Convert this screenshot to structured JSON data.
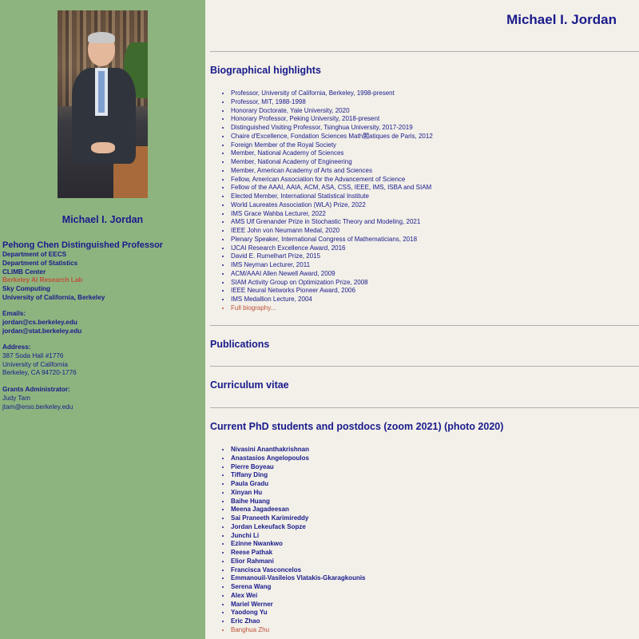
{
  "sidebar": {
    "name": "Michael I. Jordan",
    "title": "Pehong Chen Distinguished Professor",
    "affiliations": [
      {
        "label": "Department of EECS",
        "link": false
      },
      {
        "label": "Department of Statistics",
        "link": false
      },
      {
        "label": "CLIMB Center",
        "link": false
      },
      {
        "label": "Berkeley AI Research Lab",
        "link": true
      },
      {
        "label": "Sky Computing",
        "link": false
      },
      {
        "label": "University of California, Berkeley",
        "link": false
      }
    ],
    "emails_label": "Emails:",
    "emails": [
      "jordan@cs.berkeley.edu",
      "jordan@stat.berkeley.edu"
    ],
    "address_label": "Address:",
    "address": [
      "387 Soda Hall #1776",
      "University of California",
      "Berkeley, CA 94720-1776"
    ],
    "admin_label": "Grants Administrator:",
    "admin": [
      "Judy Tam",
      "jtam@erso.berkeley.edu"
    ]
  },
  "main": {
    "title": "Michael I. Jordan",
    "bio_heading": "Biographical highlights",
    "bio_items": [
      "Professor, University of California, Berkeley, 1998-present",
      "Professor, MIT, 1988-1998",
      "Honorary Doctorate, Yale University, 2020",
      "Honorary Professor, Peking University, 2018-present",
      "Distinguished Visiting Professor, Tsinghua University, 2017-2019",
      "Chaire d'Excellence, Fondation Sciences Math閣atiques de Paris, 2012",
      "Foreign Member of the Royal Society",
      "Member, National Academy of Sciences",
      "Member, National Academy of Engineering",
      "Member, American Academy of Arts and Sciences",
      "Fellow, American Association for the Advancement of Science",
      "Fellow of the AAAI, AAIA, ACM, ASA, CSS, IEEE, IMS, ISBA and SIAM",
      "Elected Member, International Statistical Institute",
      "World Laureates Association (WLA) Prize, 2022",
      "IMS Grace Wahba Lecturer, 2022",
      "AMS Ulf Grenander Prize in Stochastic Theory and Modeling, 2021",
      "IEEE John von Neumann Medal, 2020",
      "Plenary Speaker, International Congress of Mathematicians, 2018",
      "IJCAI Research Excellence Award, 2016",
      "David E. Rumelhart Prize, 2015",
      "IMS Neyman Lecturer, 2011",
      "ACM/AAAI Allen Newell Award, 2009",
      "SIAM Activity Group on Optimization Prize, 2008",
      "IEEE Neural Networks Pioneer Award, 2006",
      "IMS Medallion Lecture, 2004"
    ],
    "full_bio_link": "Full biography...",
    "publications_heading": "Publications",
    "cv_heading": "Curriculum vitae",
    "students_heading": "Current PhD students and postdocs (zoom 2021) (photo 2020)",
    "students": [
      "Nivasini Ananthakrishnan",
      "Anastasios Angelopoulos",
      "Pierre Boyeau",
      "Tiffany Ding",
      "Paula Gradu",
      "Xinyan Hu",
      "Baihe Huang",
      "Meena Jagadeesan",
      "Sai Praneeth Karimireddy",
      "Jordan Lekeufack Sopze",
      "Junchi Li",
      "Ezinne Nwankwo",
      "Reese Pathak",
      "Elior Rahmani",
      "Francisca Vasconcelos",
      "Emmanouil-Vasileios Vlatakis-Gkaragkounis",
      "Serena Wang",
      "Alex Wei",
      "Mariel Werner",
      "Yaodong Yu",
      "Eric Zhao"
    ],
    "last_student_link": "Banghua Zhu"
  }
}
